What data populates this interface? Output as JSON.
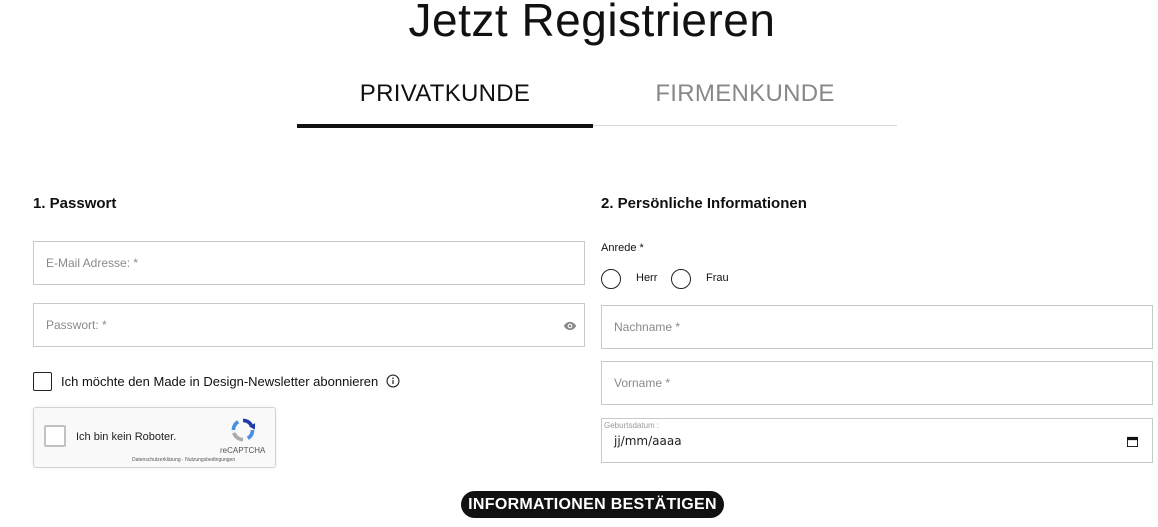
{
  "page": {
    "title": "Jetzt Registrieren"
  },
  "tabs": [
    {
      "label": "PRIVATKUNDE",
      "active": true
    },
    {
      "label": "FIRMENKUNDE",
      "active": false
    }
  ],
  "section1": {
    "title": "1. Passwort",
    "email_placeholder": "E-Mail Adresse: *",
    "password_placeholder": "Passwort: *",
    "newsletter_label": "Ich möchte den Made in Design-Newsletter abonnieren"
  },
  "recaptcha": {
    "label": "Ich bin kein Roboter.",
    "brand": "reCAPTCHA",
    "links": "Datenschutzerklärung · Nutzungsbedingungen"
  },
  "section2": {
    "title": "2. Persönliche Informationen",
    "salutation_label": "Anrede *",
    "salutation_options": [
      "Herr",
      "Frau"
    ],
    "lastname_placeholder": "Nachname *",
    "firstname_placeholder": "Vorname *",
    "birthdate_label": "Geburtsdatum :",
    "birthdate_value": "jj/mm/aaaa"
  },
  "actions": {
    "submit_label": "INFORMATIONEN BESTÄTIGEN"
  },
  "colors": {
    "text": "#111111",
    "border": "#c9c9c9",
    "inactive_tab": "#888888",
    "button_bg": "#111111"
  },
  "icons": {
    "password_toggle": "eye-icon",
    "newsletter_info": "info-icon",
    "date_picker": "calendar-icon",
    "captcha": "recaptcha-logo-icon"
  }
}
